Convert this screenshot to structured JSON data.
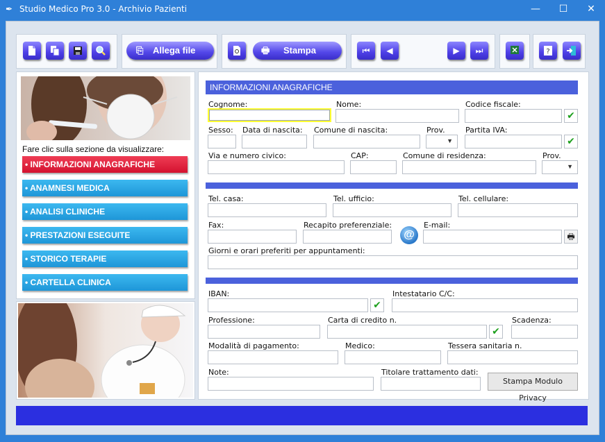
{
  "window": {
    "title": "Studio Medico Pro 3.0 - Archivio Pazienti",
    "minimize": "—",
    "maximize": "☐",
    "close": "✕"
  },
  "toolbar": {
    "allega_label": "Allega file",
    "stampa_label": "Stampa"
  },
  "leftpanel": {
    "hint": "Fare clic sulla sezione da visualizzare:",
    "nav": [
      {
        "label": "• INFORMAZIONI ANAGRAFICHE",
        "active": true
      },
      {
        "label": "• ANAMNESI MEDICA"
      },
      {
        "label": "• ANALISI CLINICHE"
      },
      {
        "label": "• PRESTAZIONI ESEGUITE"
      },
      {
        "label": "• STORICO TERAPIE"
      },
      {
        "label": "• CARTELLA CLINICA"
      }
    ]
  },
  "form": {
    "section_title": "INFORMAZIONI ANAGRAFICHE",
    "labels": {
      "cognome": "Cognome:",
      "nome": "Nome:",
      "codice_fiscale": "Codice fiscale:",
      "sesso": "Sesso:",
      "data_nascita": "Data di nascita:",
      "comune_nascita": "Comune di nascita:",
      "prov1": "Prov.",
      "partita_iva": "Partita IVA:",
      "via": "Via e numero civico:",
      "cap": "CAP:",
      "comune_residenza": "Comune di residenza:",
      "prov2": "Prov.",
      "tel_casa": "Tel. casa:",
      "tel_ufficio": "Tel. ufficio:",
      "tel_cell": "Tel. cellulare:",
      "fax": "Fax:",
      "recapito": "Recapito preferenziale:",
      "email": "E-mail:",
      "giorni": "Giorni e orari preferiti per appuntamenti:",
      "iban": "IBAN:",
      "intestatario": "Intestatario C/C:",
      "professione": "Professione:",
      "carta": "Carta di credito n.",
      "scadenza": "Scadenza:",
      "modalita": "Modalità di pagamento:",
      "medico": "Medico:",
      "tessera": "Tessera sanitaria n.",
      "note": "Note:",
      "titolare": "Titolare trattamento dati:"
    },
    "privacy_button": "Stampa Modulo Privacy"
  },
  "colors": {
    "accent": "#4b61dc",
    "nav_active": "#d4122f",
    "nav_item": "#1e96d8",
    "status_bar": "#2b2fe0"
  }
}
